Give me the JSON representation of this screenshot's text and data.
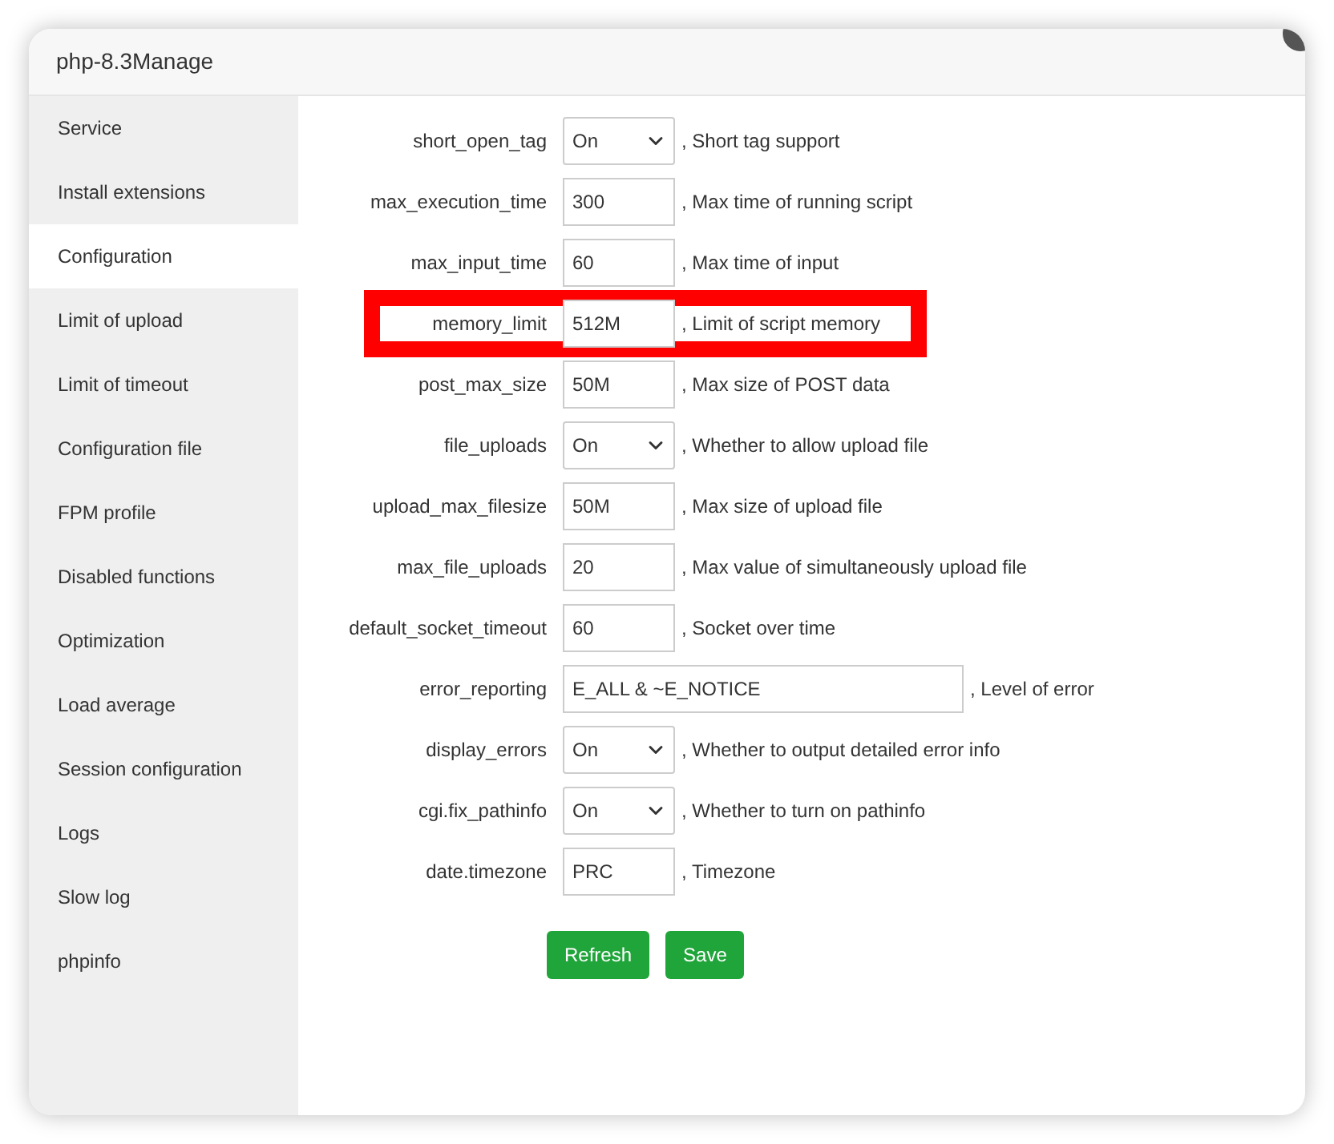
{
  "window": {
    "title": "php-8.3Manage"
  },
  "sidebar": {
    "items": [
      {
        "label": "Service",
        "selected": false
      },
      {
        "label": "Install extensions",
        "selected": false
      },
      {
        "label": "Configuration",
        "selected": true
      },
      {
        "label": "Limit of upload",
        "selected": false
      },
      {
        "label": "Limit of timeout",
        "selected": false
      },
      {
        "label": "Configuration file",
        "selected": false
      },
      {
        "label": "FPM profile",
        "selected": false
      },
      {
        "label": "Disabled functions",
        "selected": false
      },
      {
        "label": "Optimization",
        "selected": false
      },
      {
        "label": "Load average",
        "selected": false
      },
      {
        "label": "Session configuration",
        "selected": false
      },
      {
        "label": "Logs",
        "selected": false
      },
      {
        "label": "Slow log",
        "selected": false
      },
      {
        "label": "phpinfo",
        "selected": false
      }
    ]
  },
  "settings": [
    {
      "name": "short_open_tag",
      "kind": "select",
      "value": "On",
      "description": ", Short tag support",
      "highlighted": false
    },
    {
      "name": "max_execution_time",
      "kind": "text",
      "value": "300",
      "description": ", Max time of running script",
      "highlighted": false
    },
    {
      "name": "max_input_time",
      "kind": "text",
      "value": "60",
      "description": ", Max time of input",
      "highlighted": false
    },
    {
      "name": "memory_limit",
      "kind": "text",
      "value": "512M",
      "description": ", Limit of script memory",
      "highlighted": true
    },
    {
      "name": "post_max_size",
      "kind": "text",
      "value": "50M",
      "description": ", Max size of POST data",
      "highlighted": false
    },
    {
      "name": "file_uploads",
      "kind": "select",
      "value": "On",
      "description": ", Whether to allow upload file",
      "highlighted": false
    },
    {
      "name": "upload_max_filesize",
      "kind": "text",
      "value": "50M",
      "description": ", Max size of upload file",
      "highlighted": false
    },
    {
      "name": "max_file_uploads",
      "kind": "text",
      "value": "20",
      "description": ", Max value of simultaneously upload file",
      "highlighted": false
    },
    {
      "name": "default_socket_timeout",
      "kind": "text",
      "value": "60",
      "description": ", Socket over time",
      "highlighted": false
    },
    {
      "name": "error_reporting",
      "kind": "wide",
      "value": "E_ALL & ~E_NOTICE",
      "description": ", Level of error",
      "highlighted": false
    },
    {
      "name": "display_errors",
      "kind": "select",
      "value": "On",
      "description": ", Whether to output detailed error info",
      "highlighted": false
    },
    {
      "name": "cgi.fix_pathinfo",
      "kind": "select",
      "value": "On",
      "description": ", Whether to turn on pathinfo",
      "highlighted": false
    },
    {
      "name": "date.timezone",
      "kind": "text",
      "value": "PRC",
      "description": ", Timezone",
      "highlighted": false
    }
  ],
  "buttons": [
    {
      "label": "Refresh"
    },
    {
      "label": "Save"
    }
  ]
}
